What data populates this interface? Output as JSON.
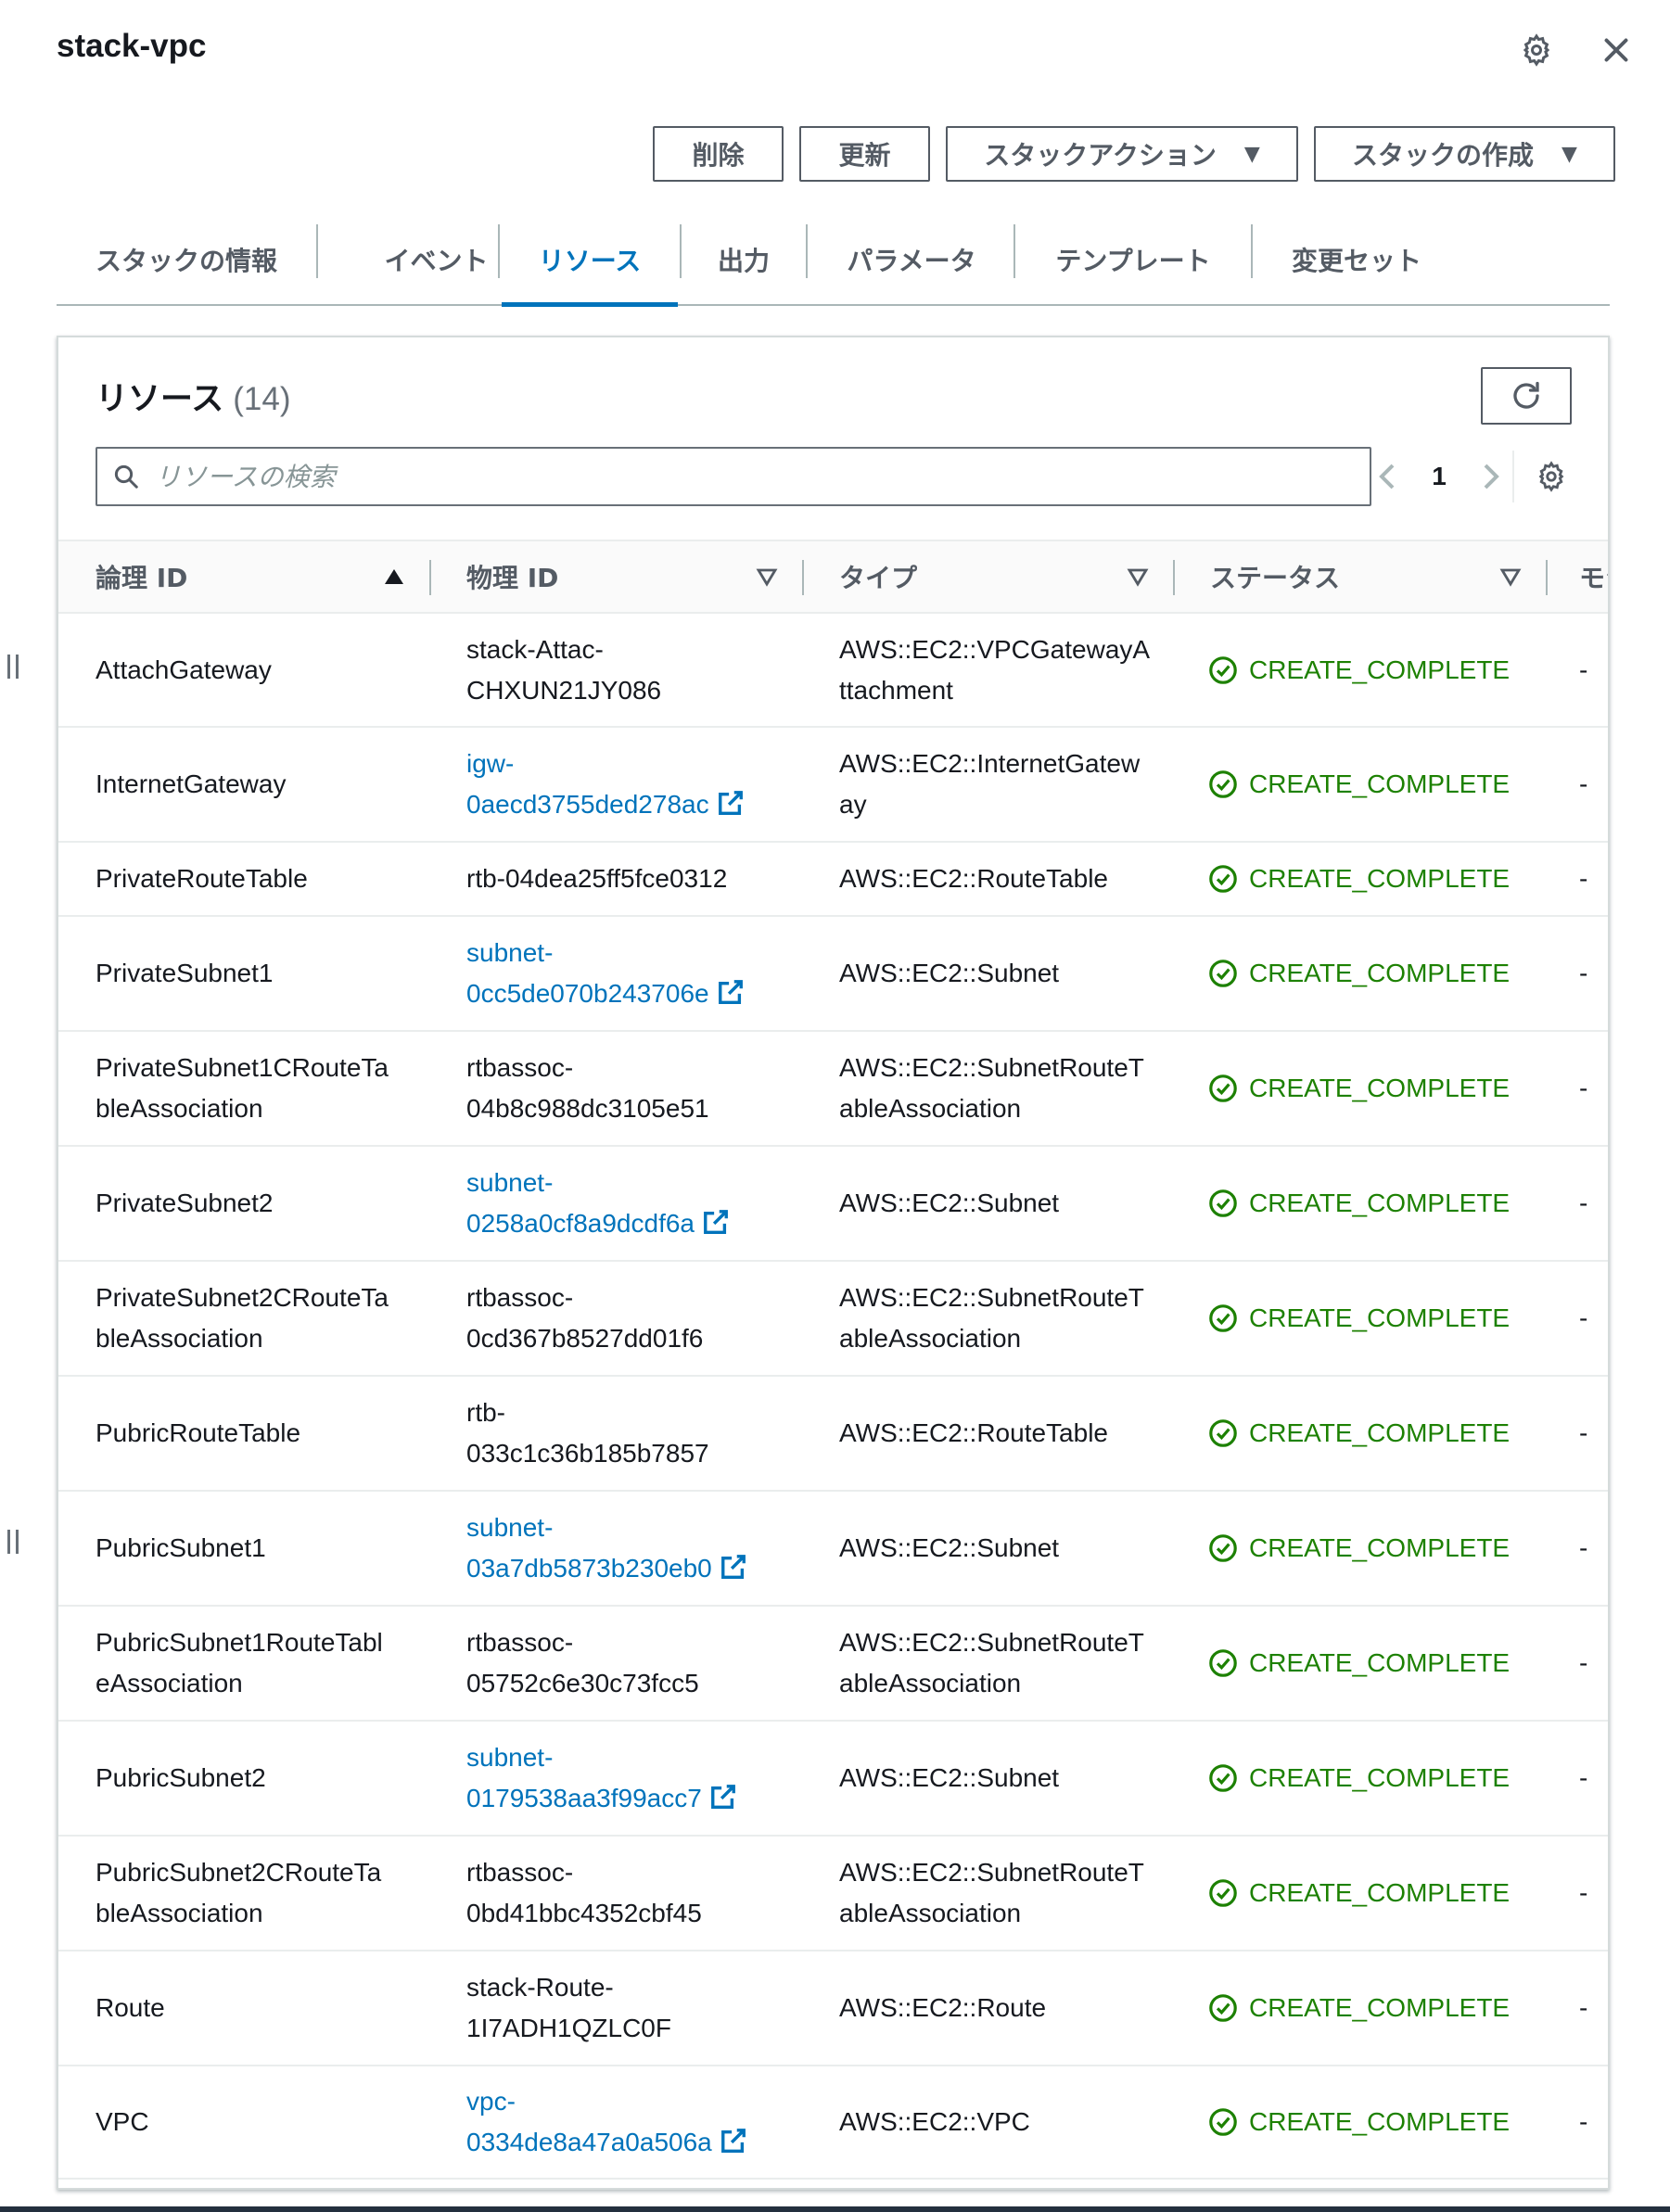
{
  "header": {
    "title": "stack-vpc"
  },
  "actions": {
    "delete_label": "削除",
    "update_label": "更新",
    "stack_actions_label": "スタックアクション",
    "create_stack_label": "スタックの作成"
  },
  "tabs": [
    {
      "label": "スタックの情報"
    },
    {
      "label": "イベント"
    },
    {
      "label": "リソース"
    },
    {
      "label": "出力"
    },
    {
      "label": "パラメータ"
    },
    {
      "label": "テンプレート"
    },
    {
      "label": "変更セット"
    }
  ],
  "active_tab": "リソース",
  "resources": {
    "title": "リソース",
    "count": "(14)",
    "search_placeholder": "リソースの検索",
    "page": "1",
    "columns": {
      "logical_id": "論理 ID",
      "physical_id": "物理 ID",
      "type": "タイプ",
      "status": "ステータス",
      "more": "モジ"
    },
    "rows": [
      {
        "logical": "AttachGateway",
        "physical": "stack-Attac-\nCHXUN21JY086",
        "link": false,
        "type": "AWS::EC2::VPCGatewayA\nttachment",
        "status": "CREATE_COMPLETE",
        "module": "-"
      },
      {
        "logical": "InternetGateway",
        "physical_a": "igw-",
        "physical_b": "0aecd3755ded278ac",
        "link": true,
        "type": "AWS::EC2::InternetGatew\nay",
        "status": "CREATE_COMPLETE",
        "module": "-"
      },
      {
        "logical": "PrivateRouteTable",
        "physical": "rtb-04dea25ff5fce0312",
        "link": false,
        "type": "AWS::EC2::RouteTable",
        "status": "CREATE_COMPLETE",
        "module": "-"
      },
      {
        "logical": "PrivateSubnet1",
        "physical_a": "subnet-",
        "physical_b": "0cc5de070b243706e",
        "link": true,
        "type": "AWS::EC2::Subnet",
        "status": "CREATE_COMPLETE",
        "module": "-"
      },
      {
        "logical": "PrivateSubnet1CRouteTa\nbleAssociation",
        "physical": "rtbassoc-\n04b8c988dc3105e51",
        "link": false,
        "type": "AWS::EC2::SubnetRouteT\nableAssociation",
        "status": "CREATE_COMPLETE",
        "module": "-"
      },
      {
        "logical": "PrivateSubnet2",
        "physical_a": "subnet-",
        "physical_b": "0258a0cf8a9dcdf6a",
        "link": true,
        "type": "AWS::EC2::Subnet",
        "status": "CREATE_COMPLETE",
        "module": "-"
      },
      {
        "logical": "PrivateSubnet2CRouteTa\nbleAssociation",
        "physical": "rtbassoc-\n0cd367b8527dd01f6",
        "link": false,
        "type": "AWS::EC2::SubnetRouteT\nableAssociation",
        "status": "CREATE_COMPLETE",
        "module": "-"
      },
      {
        "logical": "PubricRouteTable",
        "physical": "rtb-\n033c1c36b185b7857",
        "link": false,
        "type": "AWS::EC2::RouteTable",
        "status": "CREATE_COMPLETE",
        "module": "-"
      },
      {
        "logical": "PubricSubnet1",
        "physical_a": "subnet-",
        "physical_b": "03a7db5873b230eb0",
        "link": true,
        "type": "AWS::EC2::Subnet",
        "status": "CREATE_COMPLETE",
        "module": "-"
      },
      {
        "logical": "PubricSubnet1RouteTabl\neAssociation",
        "physical": "rtbassoc-\n05752c6e30c73fcc5",
        "link": false,
        "type": "AWS::EC2::SubnetRouteT\nableAssociation",
        "status": "CREATE_COMPLETE",
        "module": "-"
      },
      {
        "logical": "PubricSubnet2",
        "physical_a": "subnet-",
        "physical_b": "0179538aa3f99acc7",
        "link": true,
        "type": "AWS::EC2::Subnet",
        "status": "CREATE_COMPLETE",
        "module": "-"
      },
      {
        "logical": "PubricSubnet2CRouteTa\nbleAssociation",
        "physical": "rtbassoc-\n0bd41bbc4352cbf45",
        "link": false,
        "type": "AWS::EC2::SubnetRouteT\nableAssociation",
        "status": "CREATE_COMPLETE",
        "module": "-"
      },
      {
        "logical": "Route",
        "physical": "stack-Route-\n1I7ADH1QZLC0F",
        "link": false,
        "type": "AWS::EC2::Route",
        "status": "CREATE_COMPLETE",
        "module": "-"
      },
      {
        "logical": "VPC",
        "physical_a": "vpc-",
        "physical_b": "0334de8a47a0a506a",
        "link": true,
        "type": "AWS::EC2::VPC",
        "status": "CREATE_COMPLETE",
        "module": "-"
      }
    ]
  },
  "colors": {
    "link": "#0073bb",
    "success": "#1d8102",
    "text": "#16191f",
    "muted": "#545b64"
  },
  "icons": {
    "settings": "gear-icon",
    "close": "close-icon",
    "refresh": "refresh-icon",
    "search": "search-icon",
    "external": "external-link-icon",
    "success": "check-circle-icon"
  }
}
